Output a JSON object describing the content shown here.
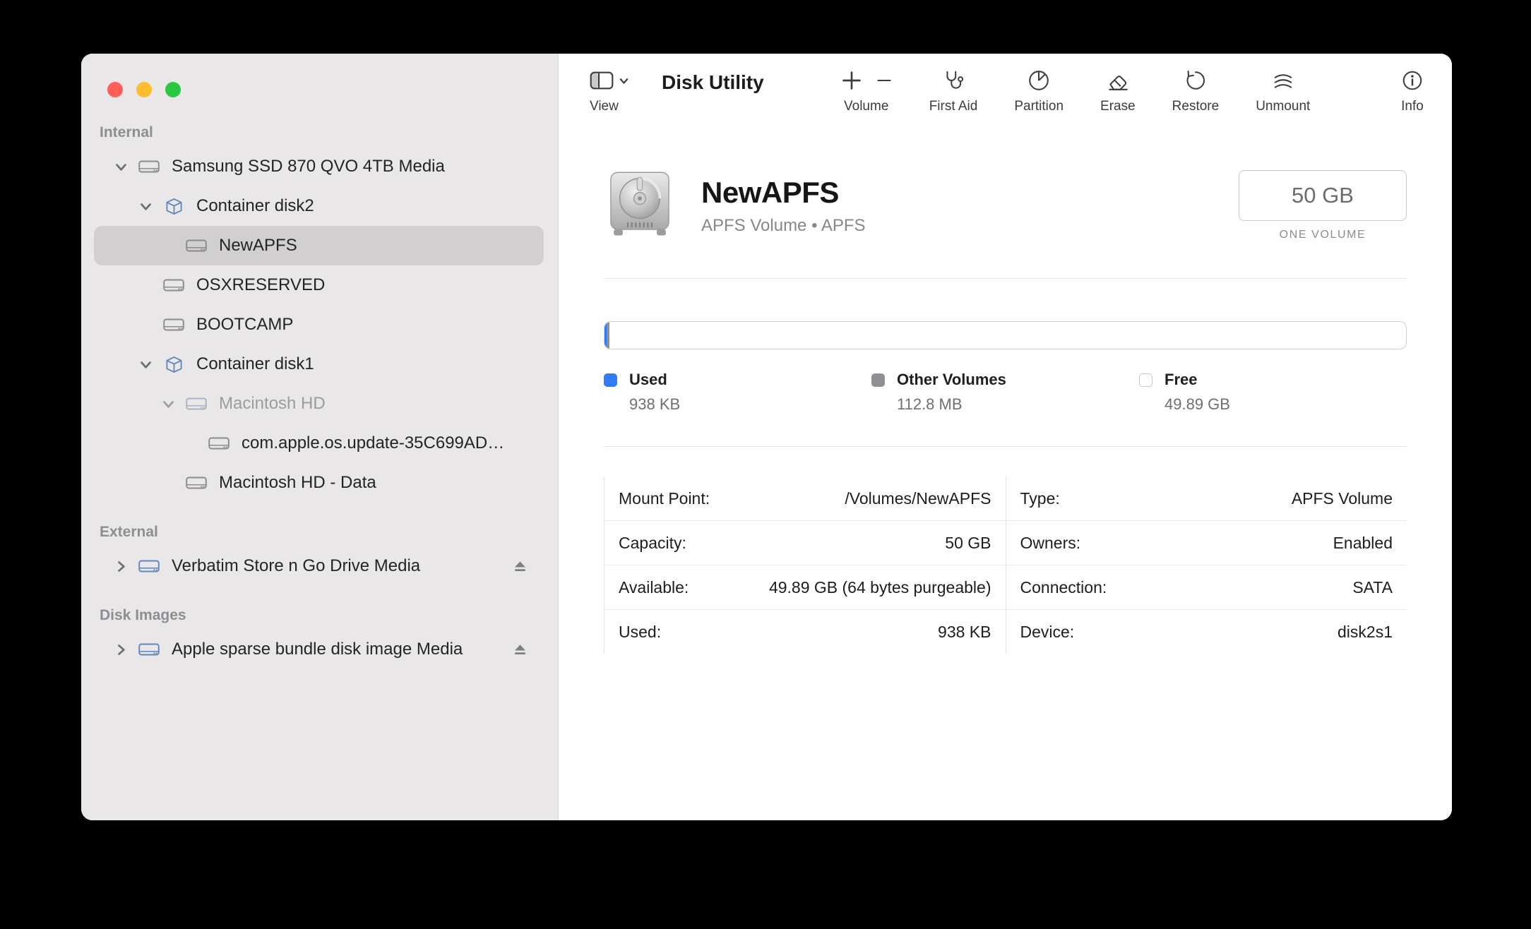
{
  "app": {
    "title": "Disk Utility"
  },
  "sidebar": {
    "sections": [
      {
        "label": "Internal",
        "items": [
          {
            "label": "Samsung SSD 870 QVO 4TB Media"
          },
          {
            "label": "Container disk2"
          },
          {
            "label": "NewAPFS",
            "selected": true
          },
          {
            "label": "OSXRESERVED"
          },
          {
            "label": "BOOTCAMP"
          },
          {
            "label": "Container disk1"
          },
          {
            "label": "Macintosh HD",
            "dimmed": true
          },
          {
            "label": "com.apple.os.update-35C699AD…"
          },
          {
            "label": "Macintosh HD - Data"
          }
        ]
      },
      {
        "label": "External",
        "items": [
          {
            "label": "Verbatim Store n Go Drive Media",
            "ejectable": true
          }
        ]
      },
      {
        "label": "Disk Images",
        "items": [
          {
            "label": "Apple sparse bundle disk image Media",
            "ejectable": true
          }
        ]
      }
    ]
  },
  "toolbar": {
    "view_label": "View",
    "title": "Disk Utility",
    "buttons": [
      {
        "label": "Volume"
      },
      {
        "label": "First Aid"
      },
      {
        "label": "Partition"
      },
      {
        "label": "Erase"
      },
      {
        "label": "Restore"
      },
      {
        "label": "Unmount"
      },
      {
        "label": "Info"
      }
    ]
  },
  "content": {
    "volume": {
      "name": "NewAPFS",
      "subtitle": "APFS Volume • APFS"
    },
    "size": {
      "value": "50 GB",
      "caption": "ONE VOLUME"
    },
    "usage_bar": {
      "segments": [
        {
          "name": "Used",
          "color": "#2f7cf6",
          "pct": 0.002
        },
        {
          "name": "Other Volumes",
          "color": "#8e8e93",
          "pct": 0.22
        },
        {
          "name": "Free",
          "color": "#ffffff",
          "pct": 99.78
        }
      ]
    },
    "legend": [
      {
        "label": "Used",
        "value": "938 KB",
        "color": "#2f7cf6"
      },
      {
        "label": "Other Volumes",
        "value": "112.8 MB",
        "color": "#8e8e93"
      },
      {
        "label": "Free",
        "value": "49.89 GB",
        "color": "#ffffff"
      }
    ],
    "details": {
      "left": [
        {
          "label": "Mount Point:",
          "value": "/Volumes/NewAPFS"
        },
        {
          "label": "Capacity:",
          "value": "50 GB"
        },
        {
          "label": "Available:",
          "value": "49.89 GB (64 bytes purgeable)"
        },
        {
          "label": "Used:",
          "value": "938 KB"
        }
      ],
      "right": [
        {
          "label": "Type:",
          "value": "APFS Volume"
        },
        {
          "label": "Owners:",
          "value": "Enabled"
        },
        {
          "label": "Connection:",
          "value": "SATA"
        },
        {
          "label": "Device:",
          "value": "disk2s1"
        }
      ]
    }
  },
  "icons": {
    "internal-drive-icon": "drive outline with activity dots",
    "container-icon": "shipping box cube outline",
    "volume-icon": "drive outline",
    "external-drive-icon": "drive outline (blue tint)",
    "disk-image-icon": "drive outline (blue tint)",
    "eject-icon": "⏏",
    "chevron-right-icon": "›",
    "chevron-down-icon": "▾",
    "sidebar-toggle-icon": "split rectangle",
    "add-volume-icon": "+",
    "remove-volume-icon": "−",
    "first-aid-icon": "stethoscope",
    "partition-icon": "pie chart",
    "erase-icon": "eraser",
    "restore-icon": "counterclockwise arrow",
    "unmount-icon": "stacked arcs",
    "info-icon": "ⓘ",
    "hard-disk-image": "gray hard disk drive illustration"
  },
  "colors": {
    "accent_blue": "#2f7cf6",
    "other_volumes_gray": "#8e8e93",
    "sidebar_bg": "#e9e7e8",
    "selection_bg": "#d2cfd1"
  }
}
